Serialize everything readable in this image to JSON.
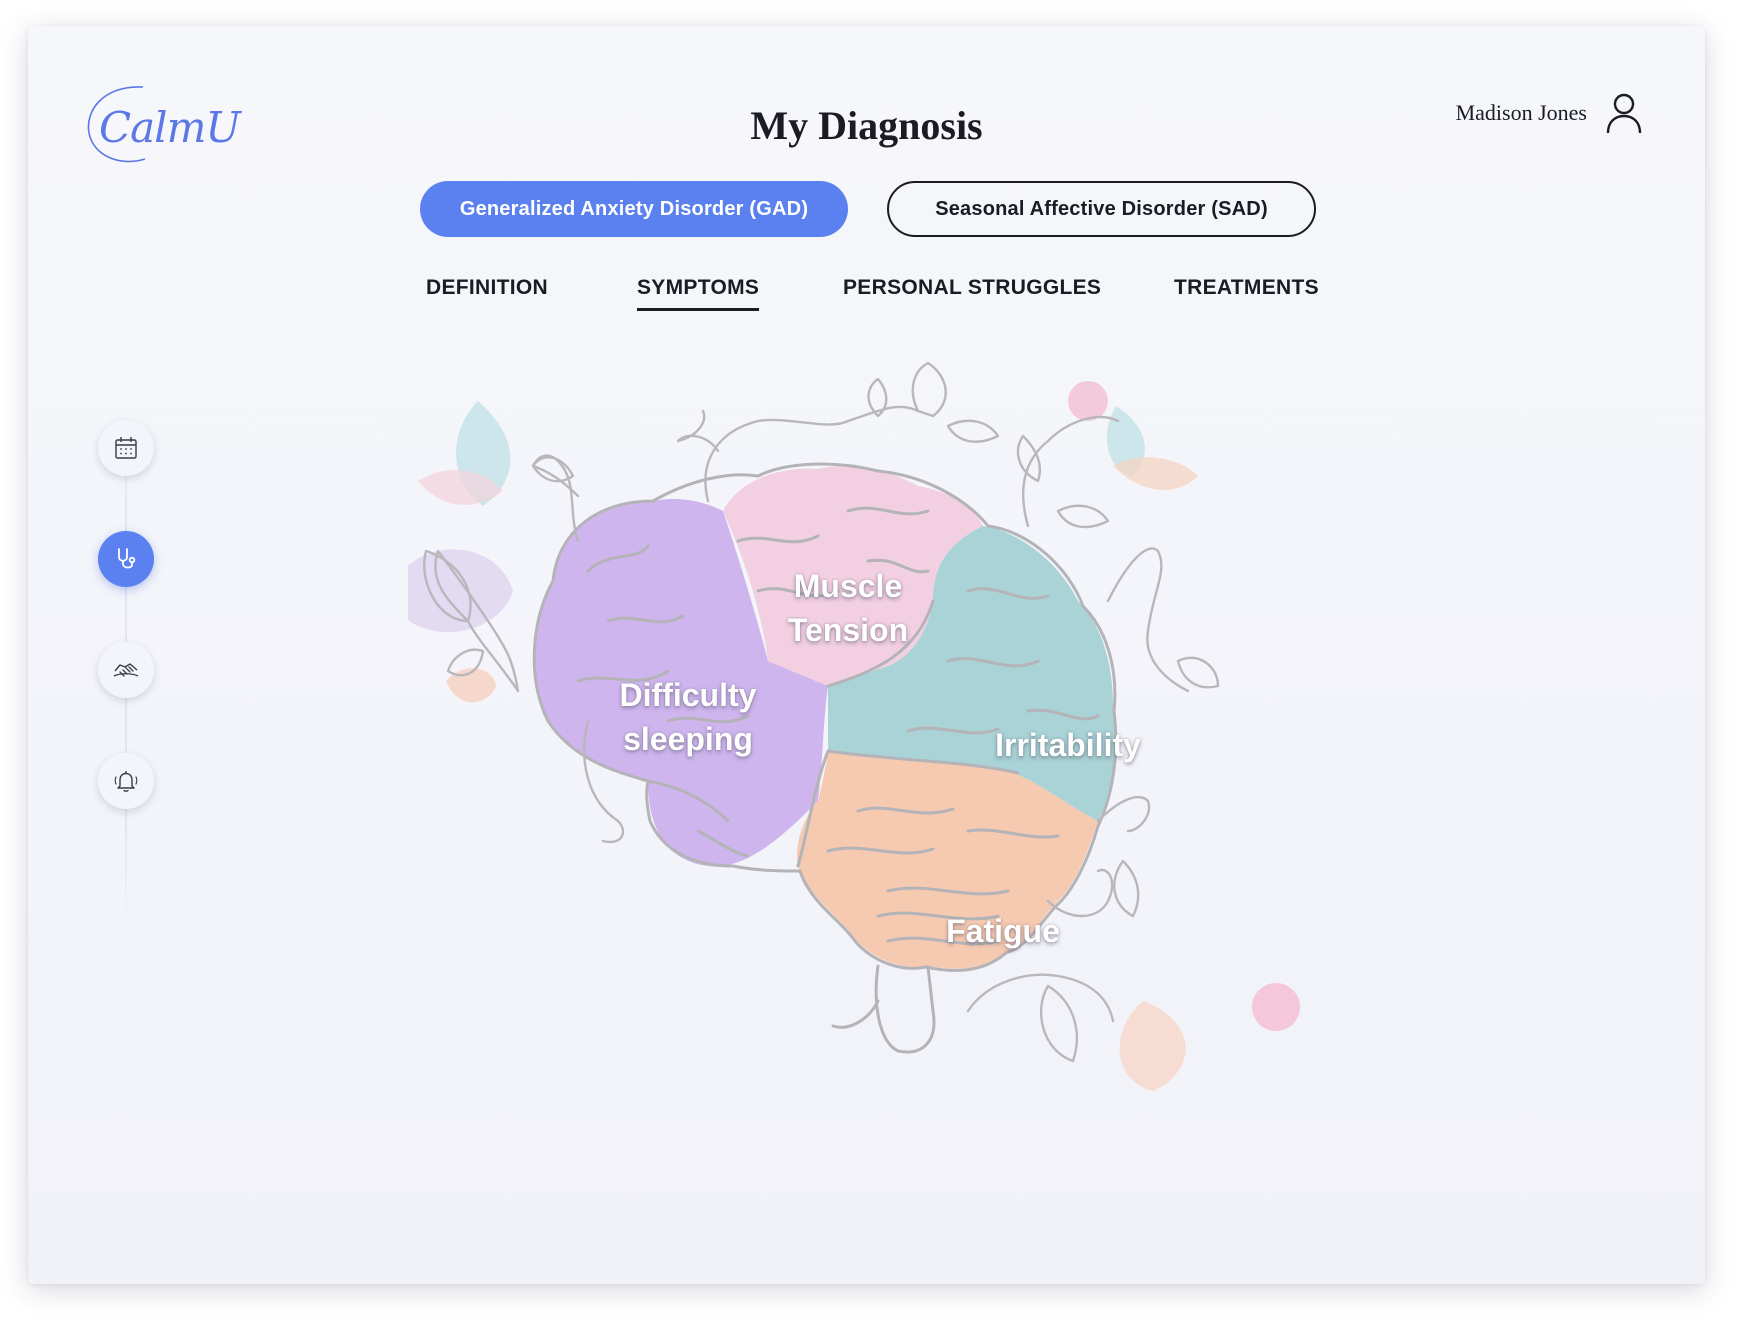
{
  "app": {
    "logo_text": "CalmU",
    "title": "My Diagnosis",
    "user_name": "Madison Jones"
  },
  "disorders": [
    {
      "label": "Generalized Anxiety Disorder (GAD)",
      "selected": true
    },
    {
      "label": "Seasonal Affective Disorder (SAD)",
      "selected": false
    }
  ],
  "tabs": [
    {
      "label": "DEFINITION",
      "active": false
    },
    {
      "label": "SYMPTOMS",
      "active": true
    },
    {
      "label": "PERSONAL STRUGGLES",
      "active": false
    },
    {
      "label": "TREATMENTS",
      "active": false
    }
  ],
  "sidebar": [
    {
      "icon": "calendar-icon",
      "active": false
    },
    {
      "icon": "stethoscope-icon",
      "active": true
    },
    {
      "icon": "handshake-icon",
      "active": false
    },
    {
      "icon": "bell-icon",
      "active": false
    }
  ],
  "brain": {
    "regions": [
      {
        "name": "Muscle Tension",
        "line1": "Muscle",
        "line2": "Tension",
        "color": "#f3cfe2"
      },
      {
        "name": "Difficulty sleeping",
        "line1": "Difficulty",
        "line2": "sleeping",
        "color": "#cfb5ee"
      },
      {
        "name": "Irritability",
        "line1": "Irritability",
        "color": "#a9d3d6"
      },
      {
        "name": "Fatigue",
        "line1": "Fatigue",
        "color": "#f6c9b1"
      }
    ]
  },
  "colors": {
    "accent": "#5b80f0",
    "text": "#1b1b24",
    "outline": "#b4b4b8"
  }
}
